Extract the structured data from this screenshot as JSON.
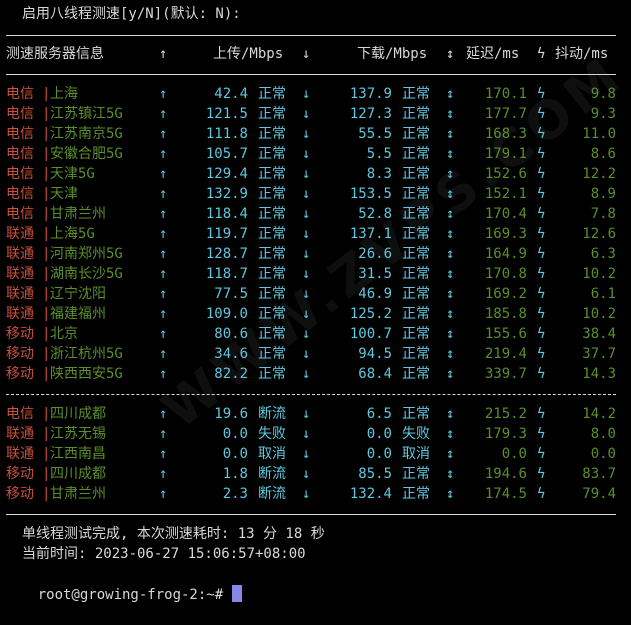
{
  "prompt": {
    "text": "启用八线程测速[y/N](默认: N):"
  },
  "table": {
    "headers": {
      "name": "测速服务器信息",
      "up_arrow": "↑",
      "upload": "上传/Mbps",
      "down_arrow": "↓",
      "download": "下载/Mbps",
      "updown_arrow": "↕",
      "latency": "延迟/ms",
      "bolt": "ϟ",
      "jitter": "抖动/ms"
    },
    "group1": [
      {
        "isp": "电信",
        "city": "上海",
        "upload": "42.4",
        "up_status": "正常",
        "download": "137.9",
        "down_status": "正常",
        "latency": "170.1",
        "jitter": "9.8"
      },
      {
        "isp": "电信",
        "city": "江苏镇江5G",
        "upload": "121.5",
        "up_status": "正常",
        "download": "127.3",
        "down_status": "正常",
        "latency": "177.7",
        "jitter": "9.3"
      },
      {
        "isp": "电信",
        "city": "江苏南京5G",
        "upload": "111.8",
        "up_status": "正常",
        "download": "55.5",
        "down_status": "正常",
        "latency": "168.3",
        "jitter": "11.0"
      },
      {
        "isp": "电信",
        "city": "安徽合肥5G",
        "upload": "105.7",
        "up_status": "正常",
        "download": "5.5",
        "down_status": "正常",
        "latency": "179.1",
        "jitter": "8.6"
      },
      {
        "isp": "电信",
        "city": "天津5G",
        "upload": "129.4",
        "up_status": "正常",
        "download": "8.3",
        "down_status": "正常",
        "latency": "152.6",
        "jitter": "12.2"
      },
      {
        "isp": "电信",
        "city": "天津",
        "upload": "132.9",
        "up_status": "正常",
        "download": "153.5",
        "down_status": "正常",
        "latency": "152.1",
        "jitter": "8.9"
      },
      {
        "isp": "电信",
        "city": "甘肃兰州",
        "upload": "118.4",
        "up_status": "正常",
        "download": "52.8",
        "down_status": "正常",
        "latency": "170.4",
        "jitter": "7.8"
      },
      {
        "isp": "联通",
        "city": "上海5G",
        "upload": "119.7",
        "up_status": "正常",
        "download": "137.1",
        "down_status": "正常",
        "latency": "169.3",
        "jitter": "12.6"
      },
      {
        "isp": "联通",
        "city": "河南郑州5G",
        "upload": "128.7",
        "up_status": "正常",
        "download": "26.6",
        "down_status": "正常",
        "latency": "164.9",
        "jitter": "6.3"
      },
      {
        "isp": "联通",
        "city": "湖南长沙5G",
        "upload": "118.7",
        "up_status": "正常",
        "download": "31.5",
        "down_status": "正常",
        "latency": "170.8",
        "jitter": "10.2"
      },
      {
        "isp": "联通",
        "city": "辽宁沈阳",
        "upload": "77.5",
        "up_status": "正常",
        "download": "46.9",
        "down_status": "正常",
        "latency": "169.2",
        "jitter": "6.1"
      },
      {
        "isp": "联通",
        "city": "福建福州",
        "upload": "109.0",
        "up_status": "正常",
        "download": "125.2",
        "down_status": "正常",
        "latency": "185.8",
        "jitter": "10.2"
      },
      {
        "isp": "移动",
        "city": "北京",
        "upload": "80.6",
        "up_status": "正常",
        "download": "100.7",
        "down_status": "正常",
        "latency": "155.6",
        "jitter": "38.4"
      },
      {
        "isp": "移动",
        "city": "浙江杭州5G",
        "upload": "34.6",
        "up_status": "正常",
        "download": "94.5",
        "down_status": "正常",
        "latency": "219.4",
        "jitter": "37.7"
      },
      {
        "isp": "移动",
        "city": "陕西西安5G",
        "upload": "82.2",
        "up_status": "正常",
        "download": "68.4",
        "down_status": "正常",
        "latency": "339.7",
        "jitter": "14.3"
      }
    ],
    "group2": [
      {
        "isp": "电信",
        "city": "四川成都",
        "upload": "19.6",
        "up_status": "断流",
        "download": "6.5",
        "down_status": "正常",
        "latency": "215.2",
        "jitter": "14.2"
      },
      {
        "isp": "联通",
        "city": "江苏无锡",
        "upload": "0.0",
        "up_status": "失败",
        "download": "0.0",
        "down_status": "失败",
        "latency": "179.3",
        "jitter": "8.0"
      },
      {
        "isp": "联通",
        "city": "江西南昌",
        "upload": "0.0",
        "up_status": "取消",
        "download": "0.0",
        "down_status": "取消",
        "latency": "0.0",
        "jitter": "0.0"
      },
      {
        "isp": "移动",
        "city": "四川成都",
        "upload": "1.8",
        "up_status": "断流",
        "download": "85.5",
        "down_status": "正常",
        "latency": "194.6",
        "jitter": "83.7"
      },
      {
        "isp": "移动",
        "city": "甘肃兰州",
        "upload": "2.3",
        "up_status": "断流",
        "download": "132.4",
        "down_status": "正常",
        "latency": "174.5",
        "jitter": "79.4"
      }
    ]
  },
  "footer": {
    "summary": "单线程测试完成, 本次测速耗时: 13 分 18 秒",
    "current_time": "当前时间: 2023-06-27 15:06:57+08:00"
  },
  "shell": {
    "prompt": "root@growing-frog-2:~# "
  },
  "watermark": {
    "text": "WWW.ZVPS.COM"
  },
  "colors": {
    "background": "#000000",
    "text": "#d8d8d8",
    "isp": "#c94f3a",
    "city": "#5a8f2a",
    "value": "#5ec8e0",
    "cursor": "#8a86e8"
  }
}
